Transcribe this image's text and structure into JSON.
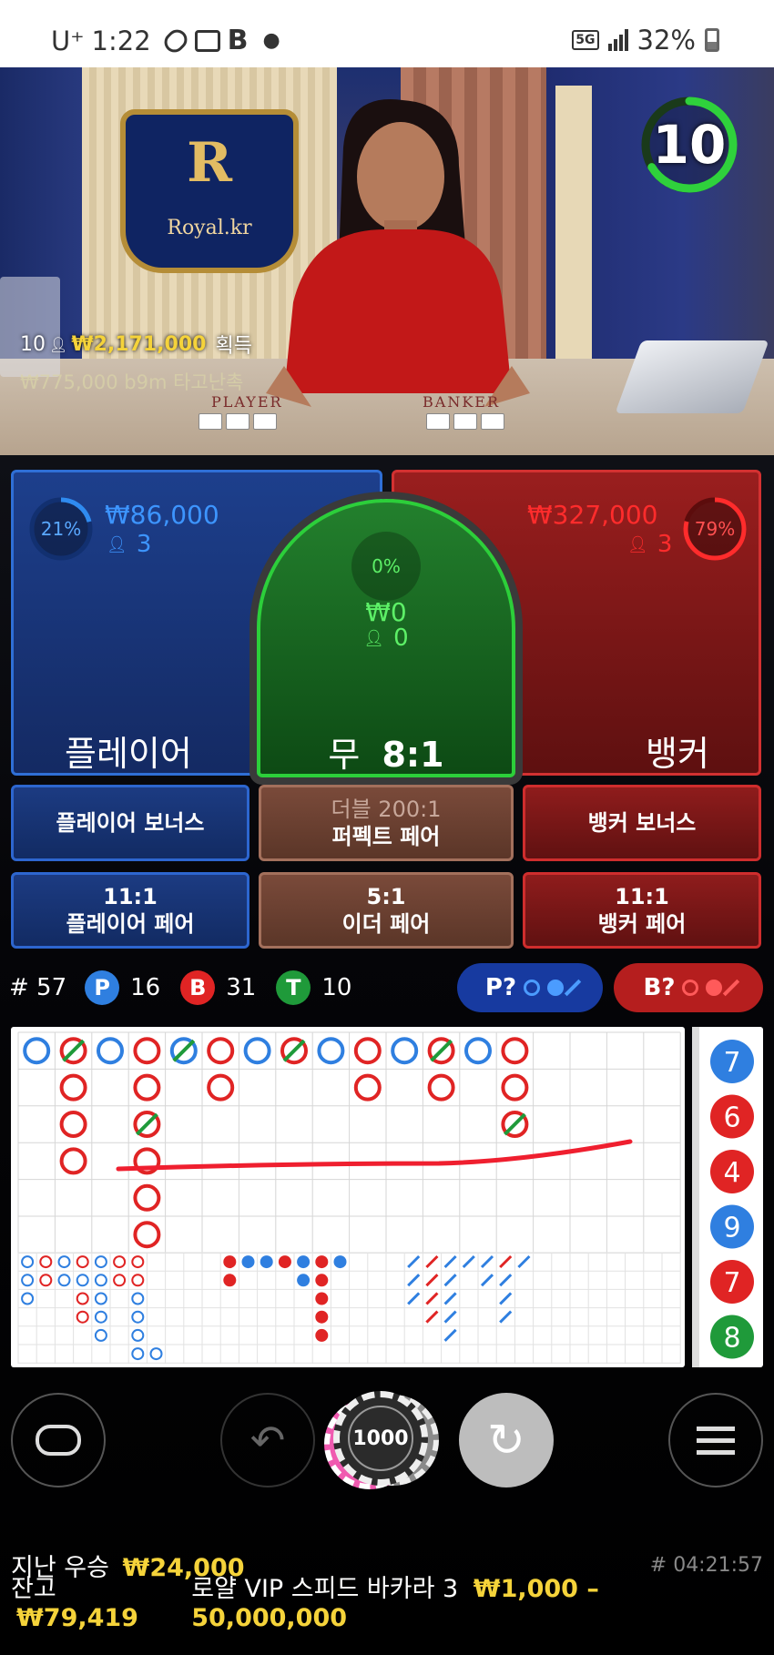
{
  "status_bar": {
    "carrier": "U⁺",
    "time": "1:22",
    "network": "5G",
    "battery": "32%"
  },
  "video": {
    "crest_letter": "R",
    "crest_name": "Royal.kr",
    "player_label": "PLAYER",
    "banker_label": "BANKER",
    "timer": "10",
    "winners_count": "10",
    "winners_amount": "₩2,171,000",
    "winners_suffix": "획득",
    "scroll_message": "₩775,000  b9m  타고난촉"
  },
  "bet_spots": {
    "player": {
      "percent": "21%",
      "percent_value": 21,
      "amount": "₩86,000",
      "players": "3",
      "label": "플레이어"
    },
    "tie": {
      "percent": "0%",
      "percent_value": 0,
      "amount": "₩0",
      "players": "0",
      "label": "무",
      "odds": "8:1"
    },
    "banker": {
      "percent": "79%",
      "percent_value": 79,
      "amount": "₩327,000",
      "players": "3",
      "label": "뱅커"
    }
  },
  "side_bets": {
    "player_bonus": "플레이어 보너스",
    "perfect_pair_top": "더블 200:1",
    "perfect_pair": "퍼펙트 페어",
    "banker_bonus": "뱅커 보너스",
    "player_pair_odds": "11:1",
    "player_pair": "플레이어 페어",
    "either_pair_odds": "5:1",
    "either_pair": "이더 페어",
    "banker_pair_odds": "11:1",
    "banker_pair": "뱅커 페어"
  },
  "stats": {
    "round": "# 57",
    "p_label": "P",
    "p_count": "16",
    "b_label": "B",
    "b_count": "31",
    "t_label": "T",
    "t_count": "10",
    "ask_player": "P?",
    "ask_banker": "B?"
  },
  "colors": {
    "player": "#2f7fe0",
    "banker": "#e02424",
    "tie": "#1f9a3a",
    "gold": "#f5d33a"
  },
  "bead_road": [
    "7",
    "6",
    "4",
    "9",
    "7",
    "8"
  ],
  "chip": {
    "value": "1000"
  },
  "controls": {
    "lobby_icon": "lobby-icon",
    "undo_icon": "undo-icon",
    "repeat_icon": "repeat-icon",
    "menu_icon": "menu-icon"
  },
  "footer": {
    "last_win_label": "지난 우승",
    "last_win_amount": "₩24,000",
    "game_id": "# 04:21:57",
    "balance_label": "잔고",
    "balance_amount": "₩79,419",
    "table_name": "로얄 VIP 스피드 바카라 3",
    "limits": "₩1,000 – 50,000,000"
  }
}
